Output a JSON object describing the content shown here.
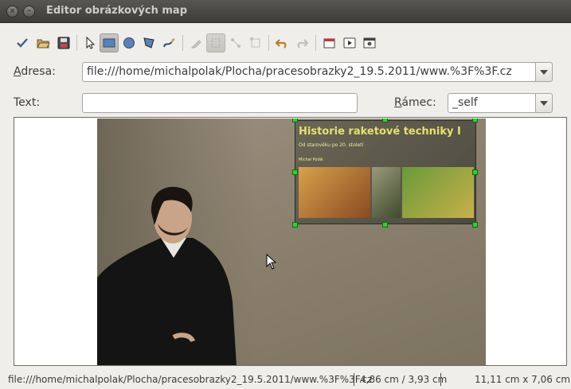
{
  "window": {
    "title": "Editor obrázkových map",
    "close_glyph": "×",
    "minimize_glyph": "–"
  },
  "toolbar": {
    "buttons": [
      {
        "name": "apply-icon",
        "state": "normal"
      },
      {
        "name": "open-icon",
        "state": "normal"
      },
      {
        "name": "save-icon",
        "state": "normal"
      },
      {
        "name": "pointer-icon",
        "state": "normal"
      },
      {
        "name": "rectangle-icon",
        "state": "active"
      },
      {
        "name": "circle-icon",
        "state": "normal"
      },
      {
        "name": "polygon-icon",
        "state": "normal"
      },
      {
        "name": "freehand-icon",
        "state": "normal"
      },
      {
        "name": "edit-area-icon",
        "state": "disabled"
      },
      {
        "name": "move-area-icon",
        "state": "active-disabled"
      },
      {
        "name": "add-point-icon",
        "state": "disabled"
      },
      {
        "name": "remove-point-icon",
        "state": "disabled"
      },
      {
        "name": "undo-icon",
        "state": "normal"
      },
      {
        "name": "redo-icon",
        "state": "disabled"
      },
      {
        "name": "new-window-icon",
        "state": "normal"
      },
      {
        "name": "preview-icon",
        "state": "normal"
      },
      {
        "name": "settings-icon",
        "state": "normal"
      }
    ]
  },
  "form": {
    "address_label_underlined": "A",
    "address_label_rest": "dresa:",
    "address_value": "file:///home/michalpolak/Plocha/pracesobrazky2_19.5.2011/www.%3F%3F.cz",
    "text_label": "Text:",
    "text_value": "",
    "frame_label_underlined": "R",
    "frame_label_rest": "ámec:",
    "frame_value": "_self"
  },
  "canvas": {
    "slide_title": "Historie raketové techniky I",
    "slide_subtitle": "Od starověku po 20. století",
    "slide_author": "Michal Polák"
  },
  "status": {
    "url": "file:///home/michalpolak/Plocha/pracesobrazky2_19.5.2011/www.%3F%3F.cz",
    "position": "4,86 cm / 3,93 cm",
    "size": "11,11 cm x 7,06 cm"
  },
  "colors": {
    "titlebar": "#3d3c37",
    "handle": "#2bd32b",
    "slide_title": "#e9e06a"
  }
}
